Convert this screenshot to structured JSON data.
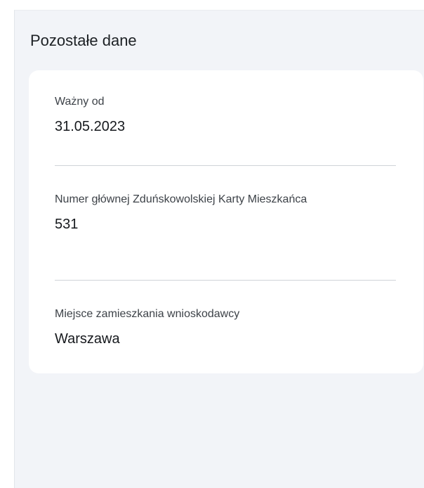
{
  "section": {
    "title": "Pozostałe dane"
  },
  "fields": [
    {
      "label": "Ważny od",
      "value": "31.05.2023"
    },
    {
      "label": "Numer głównej Zduńskowolskiej Karty Mieszkańca",
      "value": "531"
    },
    {
      "label": "Miejsce zamieszkania wnioskodawcy",
      "value": "Warszawa"
    }
  ],
  "colors": {
    "panel_background": "#f2f4f8",
    "card_background": "#ffffff",
    "text_primary": "#16191d",
    "text_secondary": "#3d4248",
    "divider": "#cfd3d8"
  }
}
